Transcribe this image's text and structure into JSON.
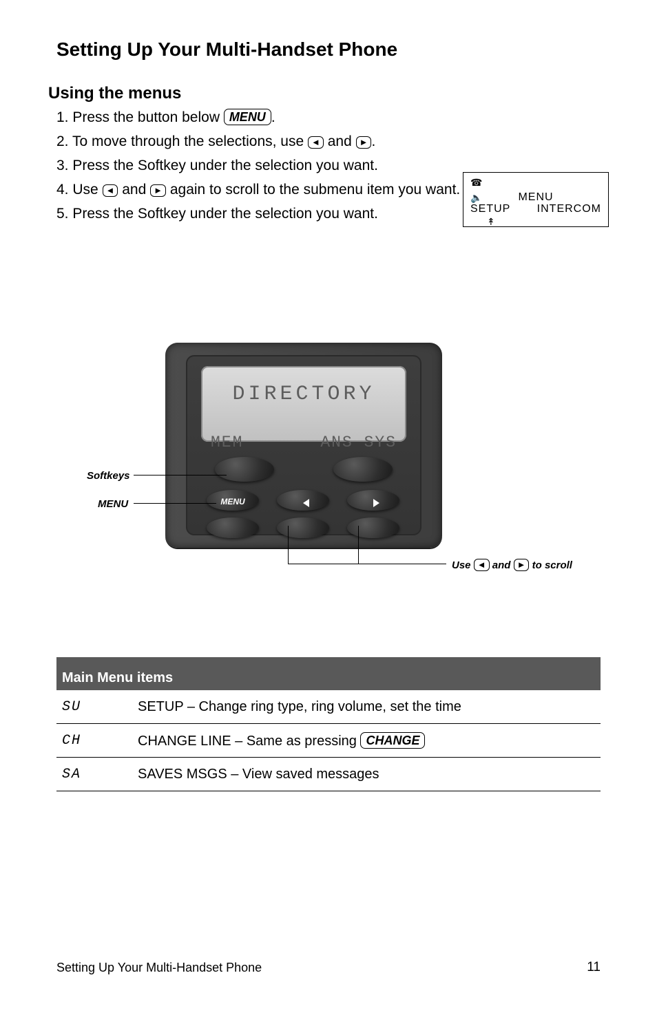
{
  "header": {
    "title": "Setting Up Your Multi-Handset Phone",
    "footer_title": "Setting Up Your Multi-Handset Phone",
    "page_number": "11"
  },
  "menus": {
    "h2": "Using the menus",
    "p1_a": "1. Press the button below ",
    "p1_b": ".",
    "p2_a": "2. To move through the selections, use ",
    "p2_b": " and ",
    "p2_c": ".",
    "p3": "3. Press the Softkey under the selection you want.",
    "p4_a": "4. Use ",
    "p4_b": " and ",
    "p4_c": " again to scroll to the submenu item you want.",
    "p5": "5. Press the Softkey under the selection you want.",
    "menu_label": "MENU",
    "left": "◄",
    "right": "►"
  },
  "small_lcd": {
    "menu": "MENU",
    "setup": "SETUP",
    "intercom": "INTERCOM"
  },
  "phone": {
    "lcd_line1": "DIRECTORY",
    "lcd_line2_left": "MEM",
    "lcd_line2_right": "ANS SYS",
    "menu_btn": "MENU",
    "callout_softkeys": "Softkeys",
    "callout_menu": "MENU",
    "callout_use_a": "Use ",
    "callout_use_b": " and ",
    "callout_use_c": " to scroll",
    "left": "◄",
    "right": "►"
  },
  "table": {
    "header": "Main Menu items",
    "rows": [
      {
        "code": "SU",
        "desc": "SETUP – Change ring type, ring volume, set the time"
      },
      {
        "code": "CH",
        "desc_a": "CHANGE LINE – Same as pressing ",
        "desc_b": "",
        "key": "CHANGE"
      },
      {
        "code": "SA",
        "desc": "SAVES MSGS – View saved messages"
      }
    ]
  }
}
